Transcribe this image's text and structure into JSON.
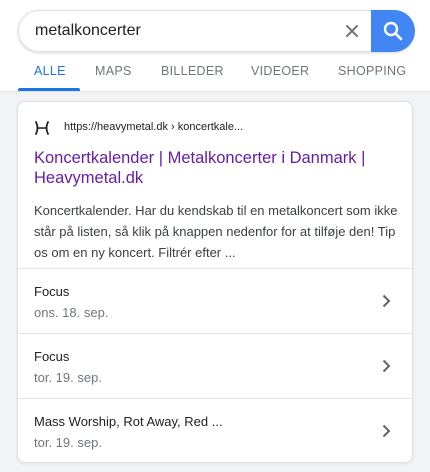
{
  "search": {
    "query": "metalkoncerter",
    "clear_icon": "close-icon",
    "submit_icon": "search-icon"
  },
  "tabs": [
    {
      "label": "ALLE",
      "active": true
    },
    {
      "label": "MAPS",
      "active": false
    },
    {
      "label": "BILLEDER",
      "active": false
    },
    {
      "label": "VIDEOER",
      "active": false
    },
    {
      "label": "SHOPPING",
      "active": false
    }
  ],
  "result": {
    "favicon": "heavymetal-favicon-icon",
    "url": "https://heavymetal.dk › koncertkale...",
    "title": "Koncertkalender | Metalkoncerter i Danmark | Heavymetal.dk",
    "snippet": "Koncertkalender. Har du kendskab til en metalkoncert som ikke står på listen, så klik på knappen nedenfor for at tilføje den! Tip os om en ny koncert. Filtrér efter ...",
    "events": [
      {
        "name": "Focus",
        "date": "ons. 18. sep."
      },
      {
        "name": "Focus",
        "date": "tor. 19. sep."
      },
      {
        "name": "Mass Worship, Rot Away, Red ...",
        "date": "tor. 19. sep."
      }
    ]
  },
  "colors": {
    "accent": "#1a73e8",
    "search_button": "#4285f4",
    "visited_link": "#681da8"
  }
}
